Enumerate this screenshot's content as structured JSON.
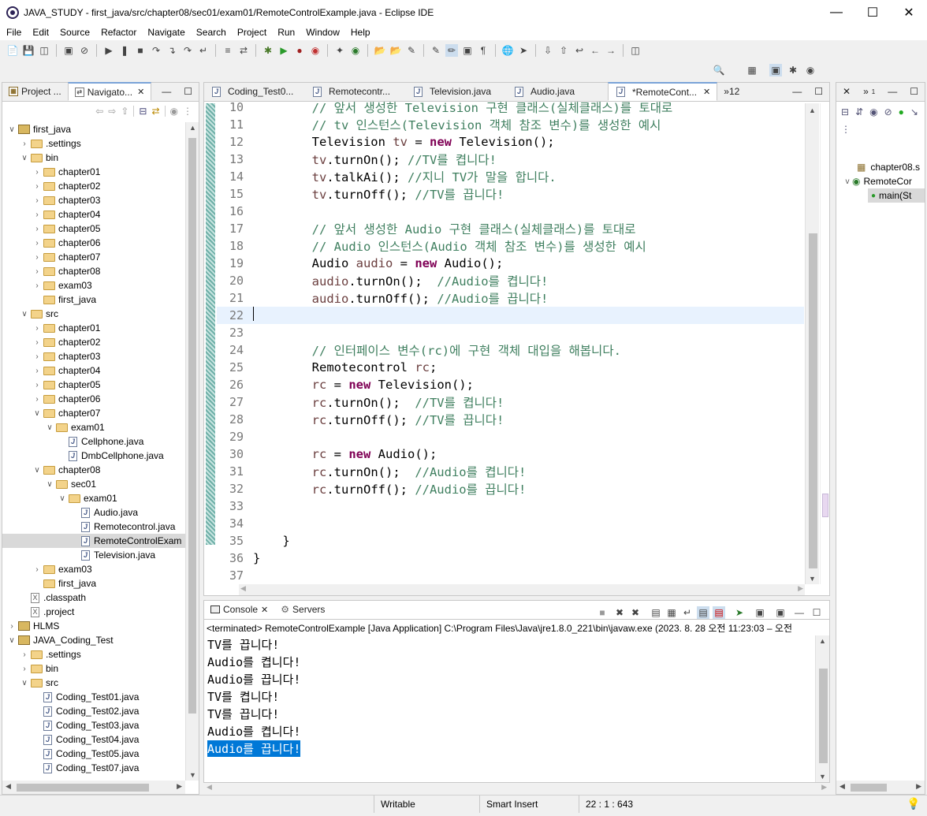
{
  "window": {
    "title": "JAVA_STUDY - first_java/src/chapter08/sec01/exam01/RemoteControlExample.java - Eclipse IDE"
  },
  "menu": [
    "File",
    "Edit",
    "Source",
    "Refactor",
    "Navigate",
    "Search",
    "Project",
    "Run",
    "Window",
    "Help"
  ],
  "left_tabs": {
    "project": "Project ...",
    "navigator": "Navigato..."
  },
  "tree": [
    {
      "indent": 0,
      "arrow": "v",
      "type": "proj",
      "label": "first_java"
    },
    {
      "indent": 1,
      "arrow": ">",
      "type": "folder",
      "label": ".settings"
    },
    {
      "indent": 1,
      "arrow": "v",
      "type": "folder",
      "label": "bin"
    },
    {
      "indent": 2,
      "arrow": ">",
      "type": "folder",
      "label": "chapter01"
    },
    {
      "indent": 2,
      "arrow": ">",
      "type": "folder",
      "label": "chapter02"
    },
    {
      "indent": 2,
      "arrow": ">",
      "type": "folder",
      "label": "chapter03"
    },
    {
      "indent": 2,
      "arrow": ">",
      "type": "folder",
      "label": "chapter04"
    },
    {
      "indent": 2,
      "arrow": ">",
      "type": "folder",
      "label": "chapter05"
    },
    {
      "indent": 2,
      "arrow": ">",
      "type": "folder",
      "label": "chapter06"
    },
    {
      "indent": 2,
      "arrow": ">",
      "type": "folder",
      "label": "chapter07"
    },
    {
      "indent": 2,
      "arrow": ">",
      "type": "folder",
      "label": "chapter08"
    },
    {
      "indent": 2,
      "arrow": ">",
      "type": "folder",
      "label": "exam03"
    },
    {
      "indent": 2,
      "arrow": "",
      "type": "folder",
      "label": "first_java"
    },
    {
      "indent": 1,
      "arrow": "v",
      "type": "folder",
      "label": "src"
    },
    {
      "indent": 2,
      "arrow": ">",
      "type": "folder",
      "label": "chapter01"
    },
    {
      "indent": 2,
      "arrow": ">",
      "type": "folder",
      "label": "chapter02"
    },
    {
      "indent": 2,
      "arrow": ">",
      "type": "folder",
      "label": "chapter03"
    },
    {
      "indent": 2,
      "arrow": ">",
      "type": "folder",
      "label": "chapter04"
    },
    {
      "indent": 2,
      "arrow": ">",
      "type": "folder",
      "label": "chapter05"
    },
    {
      "indent": 2,
      "arrow": ">",
      "type": "folder",
      "label": "chapter06"
    },
    {
      "indent": 2,
      "arrow": "v",
      "type": "folder",
      "label": "chapter07"
    },
    {
      "indent": 3,
      "arrow": "v",
      "type": "folder",
      "label": "exam01"
    },
    {
      "indent": 4,
      "arrow": "",
      "type": "java",
      "label": "Cellphone.java"
    },
    {
      "indent": 4,
      "arrow": "",
      "type": "java",
      "label": "DmbCellphone.java"
    },
    {
      "indent": 2,
      "arrow": "v",
      "type": "folder",
      "label": "chapter08"
    },
    {
      "indent": 3,
      "arrow": "v",
      "type": "folder",
      "label": "sec01"
    },
    {
      "indent": 4,
      "arrow": "v",
      "type": "folder",
      "label": "exam01"
    },
    {
      "indent": 5,
      "arrow": "",
      "type": "java",
      "label": "Audio.java"
    },
    {
      "indent": 5,
      "arrow": "",
      "type": "java",
      "label": "Remotecontrol.java"
    },
    {
      "indent": 5,
      "arrow": "",
      "type": "java",
      "label": "RemoteControlExam",
      "selected": true
    },
    {
      "indent": 5,
      "arrow": "",
      "type": "java",
      "label": "Television.java"
    },
    {
      "indent": 2,
      "arrow": ">",
      "type": "folder",
      "label": "exam03"
    },
    {
      "indent": 2,
      "arrow": "",
      "type": "folder",
      "label": "first_java"
    },
    {
      "indent": 1,
      "arrow": "",
      "type": "xfile",
      "label": ".classpath"
    },
    {
      "indent": 1,
      "arrow": "",
      "type": "xfile",
      "label": ".project"
    },
    {
      "indent": 0,
      "arrow": ">",
      "type": "proj",
      "label": "HLMS"
    },
    {
      "indent": 0,
      "arrow": "v",
      "type": "proj",
      "label": "JAVA_Coding_Test"
    },
    {
      "indent": 1,
      "arrow": ">",
      "type": "folder",
      "label": ".settings"
    },
    {
      "indent": 1,
      "arrow": ">",
      "type": "folder",
      "label": "bin"
    },
    {
      "indent": 1,
      "arrow": "v",
      "type": "folder",
      "label": "src"
    },
    {
      "indent": 2,
      "arrow": "",
      "type": "java",
      "label": "Coding_Test01.java"
    },
    {
      "indent": 2,
      "arrow": "",
      "type": "java",
      "label": "Coding_Test02.java"
    },
    {
      "indent": 2,
      "arrow": "",
      "type": "java",
      "label": "Coding_Test03.java"
    },
    {
      "indent": 2,
      "arrow": "",
      "type": "java",
      "label": "Coding_Test04.java"
    },
    {
      "indent": 2,
      "arrow": "",
      "type": "java",
      "label": "Coding_Test05.java"
    },
    {
      "indent": 2,
      "arrow": "",
      "type": "java",
      "label": "Coding_Test07.java"
    }
  ],
  "editor_tabs": [
    {
      "label": "Coding_Test0..."
    },
    {
      "label": "Remotecontr..."
    },
    {
      "label": "Television.java"
    },
    {
      "label": "Audio.java"
    },
    {
      "label": "*RemoteCont...",
      "active": true
    }
  ],
  "editor_overflow": "»12",
  "code_lines": [
    {
      "n": "10",
      "segs": [
        {
          "t": "        // 앞서 생성한 Television 구현 클래스(실체클래스)를 토대로",
          "c": "cm"
        }
      ]
    },
    {
      "n": "11",
      "segs": [
        {
          "t": "        // tv 인스턴스(Television 객체 참조 변수)를 생성한 예시",
          "c": "cm"
        }
      ]
    },
    {
      "n": "12",
      "segs": [
        {
          "t": "        Television ",
          "c": ""
        },
        {
          "t": "tv",
          "c": "vr"
        },
        {
          "t": " = ",
          "c": ""
        },
        {
          "t": "new",
          "c": "kw"
        },
        {
          "t": " Television();",
          "c": ""
        }
      ]
    },
    {
      "n": "13",
      "segs": [
        {
          "t": "        ",
          "c": ""
        },
        {
          "t": "tv",
          "c": "vr"
        },
        {
          "t": ".turnOn(); ",
          "c": ""
        },
        {
          "t": "//TV를 켭니다!",
          "c": "cm"
        }
      ]
    },
    {
      "n": "14",
      "segs": [
        {
          "t": "        ",
          "c": ""
        },
        {
          "t": "tv",
          "c": "vr"
        },
        {
          "t": ".talkAi(); ",
          "c": ""
        },
        {
          "t": "//지니 TV가 말을 합니다.",
          "c": "cm"
        }
      ]
    },
    {
      "n": "15",
      "segs": [
        {
          "t": "        ",
          "c": ""
        },
        {
          "t": "tv",
          "c": "vr"
        },
        {
          "t": ".turnOff(); ",
          "c": ""
        },
        {
          "t": "//TV를 끕니다!",
          "c": "cm"
        }
      ]
    },
    {
      "n": "16",
      "segs": []
    },
    {
      "n": "17",
      "segs": [
        {
          "t": "        // 앞서 생성한 Audio 구현 클래스(실체클래스)를 토대로",
          "c": "cm"
        }
      ]
    },
    {
      "n": "18",
      "segs": [
        {
          "t": "        // Audio 인스턴스(Audio 객체 참조 변수)를 생성한 예시",
          "c": "cm"
        }
      ]
    },
    {
      "n": "19",
      "segs": [
        {
          "t": "        Audio ",
          "c": ""
        },
        {
          "t": "audio",
          "c": "vr"
        },
        {
          "t": " = ",
          "c": ""
        },
        {
          "t": "new",
          "c": "kw"
        },
        {
          "t": " Audio();",
          "c": ""
        }
      ]
    },
    {
      "n": "20",
      "segs": [
        {
          "t": "        ",
          "c": ""
        },
        {
          "t": "audio",
          "c": "vr"
        },
        {
          "t": ".turnOn();  ",
          "c": ""
        },
        {
          "t": "//Audio를 켭니다!",
          "c": "cm"
        }
      ]
    },
    {
      "n": "21",
      "segs": [
        {
          "t": "        ",
          "c": ""
        },
        {
          "t": "audio",
          "c": "vr"
        },
        {
          "t": ".turnOff(); ",
          "c": ""
        },
        {
          "t": "//Audio를 끕니다!",
          "c": "cm"
        }
      ]
    },
    {
      "n": "22",
      "segs": [],
      "current": true
    },
    {
      "n": "23",
      "segs": []
    },
    {
      "n": "24",
      "segs": [
        {
          "t": "        // 인터페이스 변수(rc)에 구현 객체 대입을 해봅니다.",
          "c": "cm"
        }
      ]
    },
    {
      "n": "25",
      "segs": [
        {
          "t": "        Remotecontrol ",
          "c": ""
        },
        {
          "t": "rc",
          "c": "vr"
        },
        {
          "t": ";",
          "c": ""
        }
      ]
    },
    {
      "n": "26",
      "segs": [
        {
          "t": "        ",
          "c": ""
        },
        {
          "t": "rc",
          "c": "vr"
        },
        {
          "t": " = ",
          "c": ""
        },
        {
          "t": "new",
          "c": "kw"
        },
        {
          "t": " Television();",
          "c": ""
        }
      ]
    },
    {
      "n": "27",
      "segs": [
        {
          "t": "        ",
          "c": ""
        },
        {
          "t": "rc",
          "c": "vr"
        },
        {
          "t": ".turnOn();  ",
          "c": ""
        },
        {
          "t": "//TV를 켭니다!",
          "c": "cm"
        }
      ]
    },
    {
      "n": "28",
      "segs": [
        {
          "t": "        ",
          "c": ""
        },
        {
          "t": "rc",
          "c": "vr"
        },
        {
          "t": ".turnOff(); ",
          "c": ""
        },
        {
          "t": "//TV를 끕니다!",
          "c": "cm"
        }
      ]
    },
    {
      "n": "29",
      "segs": []
    },
    {
      "n": "30",
      "segs": [
        {
          "t": "        ",
          "c": ""
        },
        {
          "t": "rc",
          "c": "vr"
        },
        {
          "t": " = ",
          "c": ""
        },
        {
          "t": "new",
          "c": "kw"
        },
        {
          "t": " Audio();",
          "c": ""
        }
      ]
    },
    {
      "n": "31",
      "segs": [
        {
          "t": "        ",
          "c": ""
        },
        {
          "t": "rc",
          "c": "vr"
        },
        {
          "t": ".turnOn();  ",
          "c": ""
        },
        {
          "t": "//Audio를 켭니다!",
          "c": "cm"
        }
      ]
    },
    {
      "n": "32",
      "segs": [
        {
          "t": "        ",
          "c": ""
        },
        {
          "t": "rc",
          "c": "vr"
        },
        {
          "t": ".turnOff(); ",
          "c": ""
        },
        {
          "t": "//Audio를 끕니다!",
          "c": "cm"
        }
      ]
    },
    {
      "n": "33",
      "segs": []
    },
    {
      "n": "34",
      "segs": []
    },
    {
      "n": "35",
      "segs": [
        {
          "t": "    }",
          "c": ""
        }
      ]
    },
    {
      "n": "36",
      "segs": [
        {
          "t": "}",
          "c": ""
        }
      ]
    },
    {
      "n": "37",
      "segs": []
    }
  ],
  "outline": {
    "items": [
      {
        "label": "chapter08.s"
      },
      {
        "label": "RemoteCor"
      },
      {
        "label": "main(St"
      }
    ]
  },
  "console": {
    "tabs": {
      "console": "Console",
      "servers": "Servers"
    },
    "header": "<terminated> RemoteControlExample [Java Application] C:\\Program Files\\Java\\jre1.8.0_221\\bin\\javaw.exe  (2023. 8. 28 오전 11:23:03 – 오전",
    "lines": [
      "TV를 끕니다!",
      "Audio를 켭니다!",
      "Audio를 끕니다!",
      "TV를 켭니다!",
      "TV를 끕니다!",
      "Audio를 켭니다!",
      "Audio를 끕니다!"
    ]
  },
  "status": {
    "writable": "Writable",
    "insert": "Smart Insert",
    "position": "22 : 1 : 643"
  },
  "colors": {
    "keyword": "#7f0055",
    "comment": "#3f7f5f",
    "variable": "#6a3e3e",
    "selection": "#0078d7",
    "current_line": "#e8f2fe"
  }
}
